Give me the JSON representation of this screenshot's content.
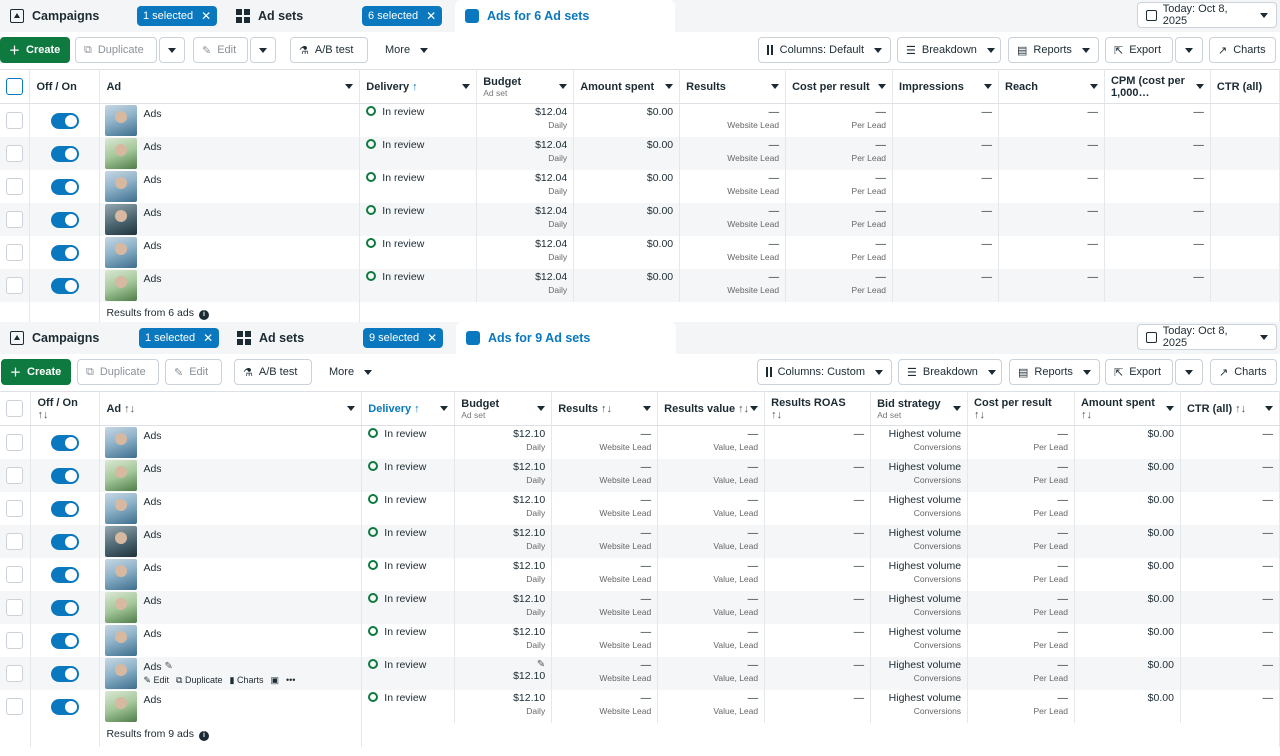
{
  "panel1": {
    "tabs": {
      "campaigns": "Campaigns",
      "campaigns_pill": "1 selected",
      "adsets": "Ad sets",
      "adsets_pill": "6 selected",
      "ads": "Ads for 6 Ad sets"
    },
    "date": "Today: Oct 8, 2025",
    "toolbar": {
      "create": "Create",
      "duplicate": "Duplicate",
      "edit": "Edit",
      "abtest": "A/B test",
      "more": "More",
      "columns": "Columns: Default",
      "breakdown": "Breakdown",
      "reports": "Reports",
      "export": "Export",
      "charts": "Charts"
    },
    "headers": {
      "offon": "Off / On",
      "ad": "Ad",
      "delivery": "Delivery",
      "budget": "Budget",
      "budget_sub": "Ad set",
      "amount": "Amount spent",
      "results": "Results",
      "cpr": "Cost per result",
      "impressions": "Impressions",
      "reach": "Reach",
      "cpm": "CPM (cost per 1,000…",
      "ctr": "CTR (all)"
    },
    "rows": [
      {
        "name": "Ads",
        "delivery": "In review",
        "budget": "$12.04",
        "budget_sub": "Daily",
        "amount": "$0.00",
        "results": "—",
        "results_sub": "Website Lead",
        "cpr": "—",
        "cpr_sub": "Per Lead",
        "impressions": "—",
        "reach": "—",
        "cpm": "—"
      },
      {
        "name": "Ads",
        "delivery": "In review",
        "budget": "$12.04",
        "budget_sub": "Daily",
        "amount": "$0.00",
        "results": "—",
        "results_sub": "Website Lead",
        "cpr": "—",
        "cpr_sub": "Per Lead",
        "impressions": "—",
        "reach": "—",
        "cpm": "—"
      },
      {
        "name": "Ads",
        "delivery": "In review",
        "budget": "$12.04",
        "budget_sub": "Daily",
        "amount": "$0.00",
        "results": "—",
        "results_sub": "Website Lead",
        "cpr": "—",
        "cpr_sub": "Per Lead",
        "impressions": "—",
        "reach": "—",
        "cpm": "—"
      },
      {
        "name": "Ads",
        "delivery": "In review",
        "budget": "$12.04",
        "budget_sub": "Daily",
        "amount": "$0.00",
        "results": "—",
        "results_sub": "Website Lead",
        "cpr": "—",
        "cpr_sub": "Per Lead",
        "impressions": "—",
        "reach": "—",
        "cpm": "—"
      },
      {
        "name": "Ads",
        "delivery": "In review",
        "budget": "$12.04",
        "budget_sub": "Daily",
        "amount": "$0.00",
        "results": "—",
        "results_sub": "Website Lead",
        "cpr": "—",
        "cpr_sub": "Per Lead",
        "impressions": "—",
        "reach": "—",
        "cpm": "—"
      },
      {
        "name": "Ads",
        "delivery": "In review",
        "budget": "$12.04",
        "budget_sub": "Daily",
        "amount": "$0.00",
        "results": "—",
        "results_sub": "Website Lead",
        "cpr": "—",
        "cpr_sub": "Per Lead",
        "impressions": "—",
        "reach": "—",
        "cpm": "—"
      }
    ],
    "footer": "Results from 6 ads"
  },
  "panel2": {
    "tabs": {
      "campaigns": "Campaigns",
      "campaigns_pill": "1 selected",
      "adsets": "Ad sets",
      "adsets_pill": "9 selected",
      "ads": "Ads for 9 Ad sets"
    },
    "date": "Today: Oct 8, 2025",
    "toolbar": {
      "create": "Create",
      "duplicate": "Duplicate",
      "edit": "Edit",
      "abtest": "A/B test",
      "more": "More",
      "columns": "Columns: Custom",
      "breakdown": "Breakdown",
      "reports": "Reports",
      "export": "Export",
      "charts": "Charts"
    },
    "headers": {
      "offon": "Off / On",
      "ad": "Ad",
      "delivery": "Delivery",
      "budget": "Budget",
      "budget_sub": "Ad set",
      "results": "Results",
      "rvalue": "Results value",
      "roas": "Results ROAS",
      "bid": "Bid strategy",
      "bid_sub": "Ad set",
      "cpr": "Cost per result",
      "amount": "Amount spent",
      "ctr": "CTR (all)"
    },
    "rows": [
      {
        "name": "Ads",
        "delivery": "In review",
        "budget": "$12.10",
        "budget_sub": "Daily",
        "results": "—",
        "results_sub": "Website Lead",
        "rvalue": "—",
        "rvalue_sub": "Value, Lead",
        "roas": "—",
        "bid": "Highest volume",
        "bid_sub": "Conversions",
        "cpr": "—",
        "cpr_sub": "Per Lead",
        "amount": "$0.00",
        "ctr": "—"
      },
      {
        "name": "Ads",
        "delivery": "In review",
        "budget": "$12.10",
        "budget_sub": "Daily",
        "results": "—",
        "results_sub": "Website Lead",
        "rvalue": "—",
        "rvalue_sub": "Value, Lead",
        "roas": "—",
        "bid": "Highest volume",
        "bid_sub": "Conversions",
        "cpr": "—",
        "cpr_sub": "Per Lead",
        "amount": "$0.00",
        "ctr": "—"
      },
      {
        "name": "Ads",
        "delivery": "In review",
        "budget": "$12.10",
        "budget_sub": "Daily",
        "results": "—",
        "results_sub": "Website Lead",
        "rvalue": "—",
        "rvalue_sub": "Value, Lead",
        "roas": "—",
        "bid": "Highest volume",
        "bid_sub": "Conversions",
        "cpr": "—",
        "cpr_sub": "Per Lead",
        "amount": "$0.00",
        "ctr": "—"
      },
      {
        "name": "Ads",
        "delivery": "In review",
        "budget": "$12.10",
        "budget_sub": "Daily",
        "results": "—",
        "results_sub": "Website Lead",
        "rvalue": "—",
        "rvalue_sub": "Value, Lead",
        "roas": "—",
        "bid": "Highest volume",
        "bid_sub": "Conversions",
        "cpr": "—",
        "cpr_sub": "Per Lead",
        "amount": "$0.00",
        "ctr": "—"
      },
      {
        "name": "Ads",
        "delivery": "In review",
        "budget": "$12.10",
        "budget_sub": "Daily",
        "results": "—",
        "results_sub": "Website Lead",
        "rvalue": "—",
        "rvalue_sub": "Value, Lead",
        "roas": "—",
        "bid": "Highest volume",
        "bid_sub": "Conversions",
        "cpr": "—",
        "cpr_sub": "Per Lead",
        "amount": "$0.00",
        "ctr": "—"
      },
      {
        "name": "Ads",
        "delivery": "In review",
        "budget": "$12.10",
        "budget_sub": "Daily",
        "results": "—",
        "results_sub": "Website Lead",
        "rvalue": "—",
        "rvalue_sub": "Value, Lead",
        "roas": "—",
        "bid": "Highest volume",
        "bid_sub": "Conversions",
        "cpr": "—",
        "cpr_sub": "Per Lead",
        "amount": "$0.00",
        "ctr": "—"
      },
      {
        "name": "Ads",
        "delivery": "In review",
        "budget": "$12.10",
        "budget_sub": "Daily",
        "results": "—",
        "results_sub": "Website Lead",
        "rvalue": "—",
        "rvalue_sub": "Value, Lead",
        "roas": "—",
        "bid": "Highest volume",
        "bid_sub": "Conversions",
        "cpr": "—",
        "cpr_sub": "Per Lead",
        "amount": "$0.00",
        "ctr": "—"
      },
      {
        "name": "Ads",
        "delivery": "In review",
        "budget": "$12.10",
        "budget_sub": "",
        "results": "—",
        "results_sub": "Website Lead",
        "rvalue": "—",
        "rvalue_sub": "Value, Lead",
        "roas": "—",
        "bid": "Highest volume",
        "bid_sub": "Conversions",
        "cpr": "—",
        "cpr_sub": "Per Lead",
        "amount": "$0.00",
        "ctr": "—"
      },
      {
        "name": "Ads",
        "delivery": "In review",
        "budget": "$12.10",
        "budget_sub": "Daily",
        "results": "—",
        "results_sub": "Website Lead",
        "rvalue": "—",
        "rvalue_sub": "Value, Lead",
        "roas": "—",
        "bid": "Highest volume",
        "bid_sub": "Conversions",
        "cpr": "—",
        "cpr_sub": "Per Lead",
        "amount": "$0.00",
        "ctr": "—"
      }
    ],
    "hover_actions": {
      "edit": "Edit",
      "duplicate": "Duplicate",
      "charts": "Charts",
      "more": "•••"
    },
    "footer": "Results from 9 ads"
  },
  "colors": {
    "accent": "#0a78be",
    "create": "#0f7a3f",
    "status": "#0f7a3f"
  }
}
